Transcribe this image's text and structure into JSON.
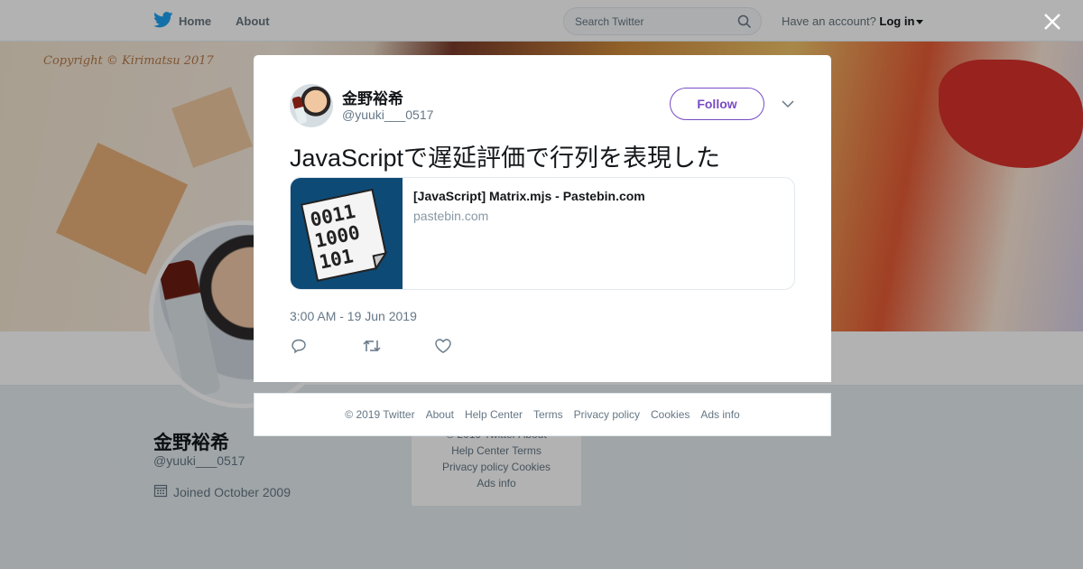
{
  "topbar": {
    "home_label": "Home",
    "about_label": "About",
    "search_placeholder": "Search Twitter",
    "account_prompt": "Have an account?",
    "login_label": "Log in"
  },
  "banner": {
    "caption": "Copyright © Kirimatsu 2017"
  },
  "profile": {
    "name": "金野裕希",
    "handle": "@yuuki___0517",
    "joined": "Joined October 2009"
  },
  "side_footer": {
    "lines": [
      "© 2019 Twitter   About",
      "Help Center   Terms",
      "Privacy policy   Cookies",
      "Ads info"
    ]
  },
  "tweet": {
    "author_name": "金野裕希",
    "author_handle": "@yuuki___0517",
    "follow_label": "Follow",
    "text": "JavaScriptで遅延評価で行列を表現した",
    "card": {
      "title": "[JavaScript] Matrix.mjs - Pastebin.com",
      "domain": "pastebin.com",
      "image_lines": [
        "0011",
        "1000",
        "101"
      ]
    },
    "timestamp": "3:00 AM - 19 Jun 2019"
  },
  "modal_footer": {
    "links": [
      "© 2019 Twitter",
      "About",
      "Help Center",
      "Terms",
      "Privacy policy",
      "Cookies",
      "Ads info"
    ]
  },
  "colors": {
    "twitter_blue": "#1da1f2",
    "follow_purple": "#794bc4",
    "pastebin_blue": "#0e4a76"
  },
  "icons": {
    "brand": "twitter-bird-icon",
    "search": "search-icon",
    "close": "close-icon",
    "menu": "chevron-down-icon",
    "reply": "reply-icon",
    "retweet": "retweet-icon",
    "like": "heart-icon",
    "calendar": "calendar-icon"
  }
}
